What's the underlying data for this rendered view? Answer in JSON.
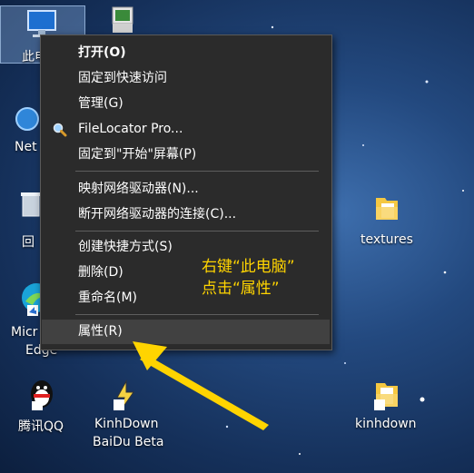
{
  "desktop": {
    "this_pc_label": "此电",
    "network_label": "Net",
    "recycle_label": "回",
    "edge_label_1": "Micr",
    "edge_label_2": "Edge",
    "textures_label": "textures",
    "qq_label": "腾讯QQ",
    "kinhdown_baidu_line1": "KinhDown",
    "kinhdown_baidu_line2": "BaiDu Beta",
    "kinhdown_label": "kinhdown"
  },
  "context_menu": {
    "items": [
      {
        "label": "打开(O)"
      },
      {
        "label": "固定到快速访问"
      },
      {
        "label": "管理(G)"
      },
      {
        "label": "FileLocator Pro..."
      },
      {
        "label": "固定到\"开始\"屏幕(P)"
      },
      {
        "label": "映射网络驱动器(N)..."
      },
      {
        "label": "断开网络驱动器的连接(C)..."
      },
      {
        "label": "创建快捷方式(S)"
      },
      {
        "label": "删除(D)"
      },
      {
        "label": "重命名(M)"
      },
      {
        "label": "属性(R)"
      }
    ]
  },
  "annotation": {
    "line1": "右键“此电脑”",
    "line2": "点击“属性”",
    "color": "#ffd400"
  }
}
